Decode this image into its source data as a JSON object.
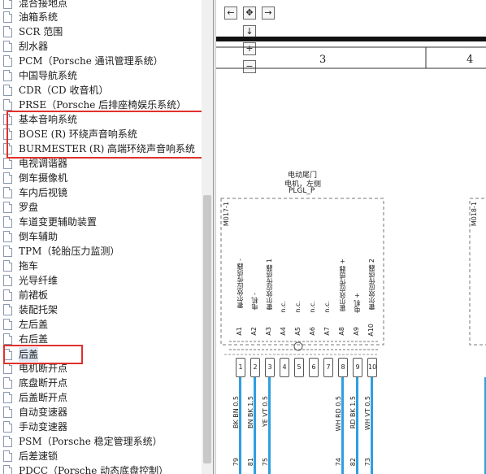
{
  "tree": {
    "items": [
      {
        "label": "混合接地点"
      },
      {
        "label": "油箱系统"
      },
      {
        "label": "SCR 范围"
      },
      {
        "label": "刮水器"
      },
      {
        "label": "PCM（Porsche 通讯管理系统）"
      },
      {
        "label": "中国导航系统"
      },
      {
        "label": "CDR（CD 收音机）"
      },
      {
        "label": "PRSE（Porsche 后排座椅娱乐系统）"
      },
      {
        "label": "基本音响系统"
      },
      {
        "label": "BOSE (R) 环绕声音响系统"
      },
      {
        "label": "BURMESTER (R) 高端环绕声音响系统"
      },
      {
        "label": "电视调谐器"
      },
      {
        "label": "倒车摄像机"
      },
      {
        "label": "车内后视镜"
      },
      {
        "label": "罗盘"
      },
      {
        "label": "车道变更辅助装置"
      },
      {
        "label": "倒车辅助"
      },
      {
        "label": "TPM（轮胎压力监测）"
      },
      {
        "label": "拖车"
      },
      {
        "label": "光导纤维"
      },
      {
        "label": "前裙板"
      },
      {
        "label": "装配托架"
      },
      {
        "label": "左后盖"
      },
      {
        "label": "右后盖"
      },
      {
        "label": "后盖"
      },
      {
        "label": "电机断开点"
      },
      {
        "label": "底盘断开点"
      },
      {
        "label": "后盖断开点"
      },
      {
        "label": "自动变速器"
      },
      {
        "label": "手动变速器"
      },
      {
        "label": "PSM（Porsche 稳定管理系统）"
      },
      {
        "label": "后差速锁"
      },
      {
        "label": "PDCC（Porsche 动态底盘控制）"
      }
    ],
    "selected_label": "后盖"
  },
  "diagram": {
    "nav_buttons": {
      "left": "←",
      "center": "✥",
      "right": "→",
      "down": "↓",
      "zoom_in": "+",
      "zoom_out": "−"
    },
    "columns": [
      "3",
      "4"
    ],
    "component": {
      "title_1": "电动尾门",
      "title_2": "电机，左侧",
      "code": "PLGL_P",
      "id": "M017-1"
    },
    "component_right_id": "M018-1",
    "pin_functions": [
      "霍尔效应传感器 -",
      "电机 -",
      "霍尔效应传感器 1",
      "n.c.",
      "n.c.",
      "n.c.",
      "n.c.",
      "霍尔效应传感器 +",
      "电机 +",
      "霍尔效应传感器 2"
    ],
    "pin_ids": [
      "A1",
      "A2",
      "A3",
      "A4",
      "A5",
      "A6",
      "A7",
      "A8",
      "A9",
      "A10"
    ],
    "connector_numbers": [
      "1",
      "2",
      "3",
      "4",
      "5",
      "6",
      "7",
      "8",
      "9",
      "10"
    ],
    "wires": [
      {
        "label": "BK BN 0.5",
        "num": "79"
      },
      {
        "label": "BN BK 1.5",
        "num": "81"
      },
      {
        "label": "YE VT 0.5",
        "num": "75"
      },
      {
        "label": "WH RD 0.5",
        "num": "74"
      },
      {
        "label": "RD BK 1.5",
        "num": "82"
      },
      {
        "label": "WH VT 0.5",
        "num": "73"
      }
    ]
  },
  "colors": {
    "highlight": "#e0312c",
    "wire": "#2f9fe0",
    "selected_bg": "#dfe8f4"
  }
}
